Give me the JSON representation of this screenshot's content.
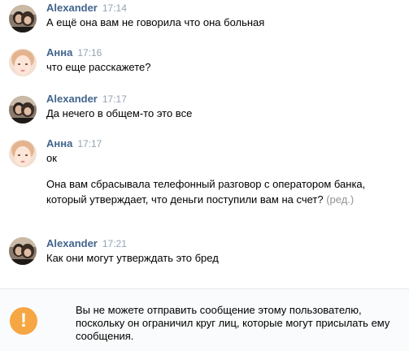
{
  "messages": [
    {
      "author": "Alexander",
      "time": "17:14",
      "avatar": "alexander-avatar",
      "lines": [
        "А ещё она вам не говорила что она больная"
      ]
    },
    {
      "author": "Анна",
      "time": "17:16",
      "avatar": "anna-avatar",
      "lines": [
        "что еще расскажете?"
      ]
    },
    {
      "author": "Alexander",
      "time": "17:17",
      "avatar": "alexander-avatar",
      "lines": [
        "Да нечего в общем-то это все"
      ]
    },
    {
      "author": "Анна",
      "time": "17:17",
      "avatar": "anna-avatar",
      "lines": [
        "ок",
        "Она вам сбрасывала телефонный разговор с оператором банка, который утверждает, что деньги поступили вам на счет?"
      ],
      "edited_label": "(ред.)"
    },
    {
      "author": "Alexander",
      "time": "17:21",
      "avatar": "alexander-avatar",
      "lines": [
        "Как они могут утверждать это бред"
      ]
    }
  ],
  "notice": {
    "icon": "exclamation-icon",
    "icon_glyph": "!",
    "text": "Вы не можете отправить сообщение этому пользователю, поскольку он ограничил круг лиц, которые могут присылать ему сообщения."
  },
  "colors": {
    "author_name": "#42648b",
    "timestamp": "#93a3b3",
    "warning": "#f6a643",
    "notice_background": "#fafbfc"
  }
}
